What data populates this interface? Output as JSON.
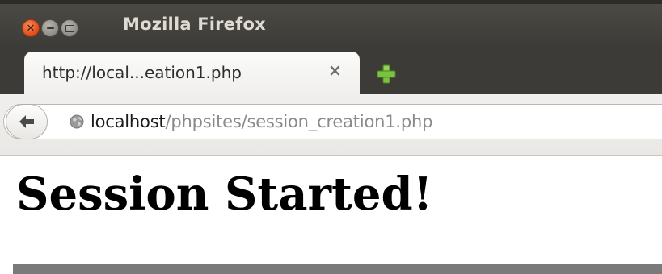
{
  "window": {
    "title": "Mozilla Firefox",
    "controls": {
      "close": "close-icon",
      "minimize": "minimize-icon",
      "maximize": "maximize-icon"
    }
  },
  "tabs": [
    {
      "title": "http://local...eation1.php",
      "close_symbol": "×",
      "active": true
    }
  ],
  "new_tab_icon": "plus-icon",
  "navbar": {
    "back_icon": "back-arrow-icon",
    "site_icon": "globe-icon",
    "url_host": "localhost",
    "url_path": "/phpsites/session_creation1.php"
  },
  "page": {
    "heading": "Session Started!"
  },
  "colors": {
    "titlebar": "#3c3b37",
    "title_text": "#dfdbd2",
    "close_button": "#df4a16",
    "new_tab_plus": "#7bc142",
    "url_host": "#1a1a1a",
    "url_path": "#8a8a8a",
    "bottom_bar": "#7a7a7a"
  }
}
